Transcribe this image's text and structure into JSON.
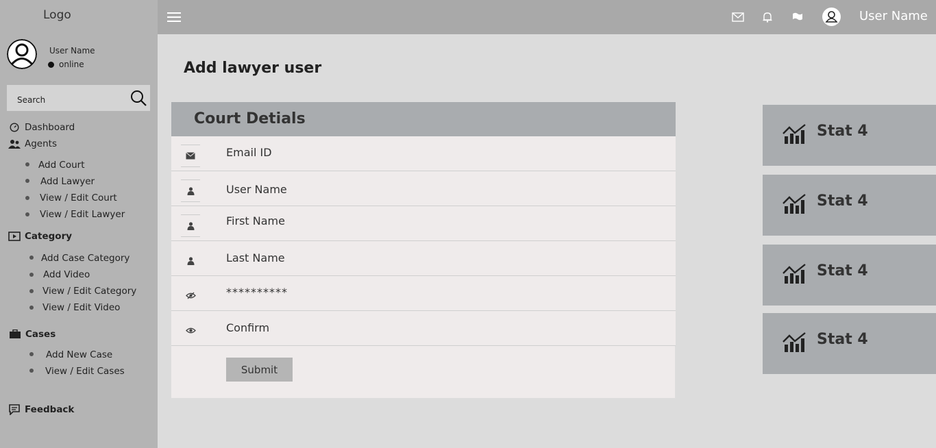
{
  "app": {
    "logo": "Logo",
    "user_name": "User Name"
  },
  "sidebar": {
    "profile": {
      "name": "User Name",
      "status": "online"
    },
    "search_placeholder": "Search",
    "nav": {
      "dashboard": "Dashboard",
      "agents": "Agents",
      "agents_items": [
        "Add Court",
        "Add Lawyer",
        "View / Edit Court",
        "View / Edit Lawyer"
      ],
      "category": "Category",
      "category_items": [
        "Add Case Category",
        "Add Video",
        "View / Edit Category",
        "View / Edit Video"
      ],
      "cases": "Cases",
      "cases_items": [
        "Add New Case",
        "View / Edit Cases"
      ],
      "feedback": "Feedback"
    }
  },
  "topbar": {
    "icons": [
      "mail-icon",
      "bell-icon",
      "flag-icon",
      "user-avatar-icon"
    ],
    "user_name": "User Name"
  },
  "main": {
    "title": "Add lawyer user",
    "form": {
      "header": "Court Detials",
      "fields": {
        "email": "Email ID",
        "username": "User Name",
        "first_name": "First Name",
        "last_name": "Last Name",
        "password": "**********",
        "confirm": "Confirm"
      },
      "submit_label": "Submit"
    },
    "stats": [
      "Stat 4",
      "Stat 4",
      "Stat 4",
      "Stat 4"
    ]
  }
}
